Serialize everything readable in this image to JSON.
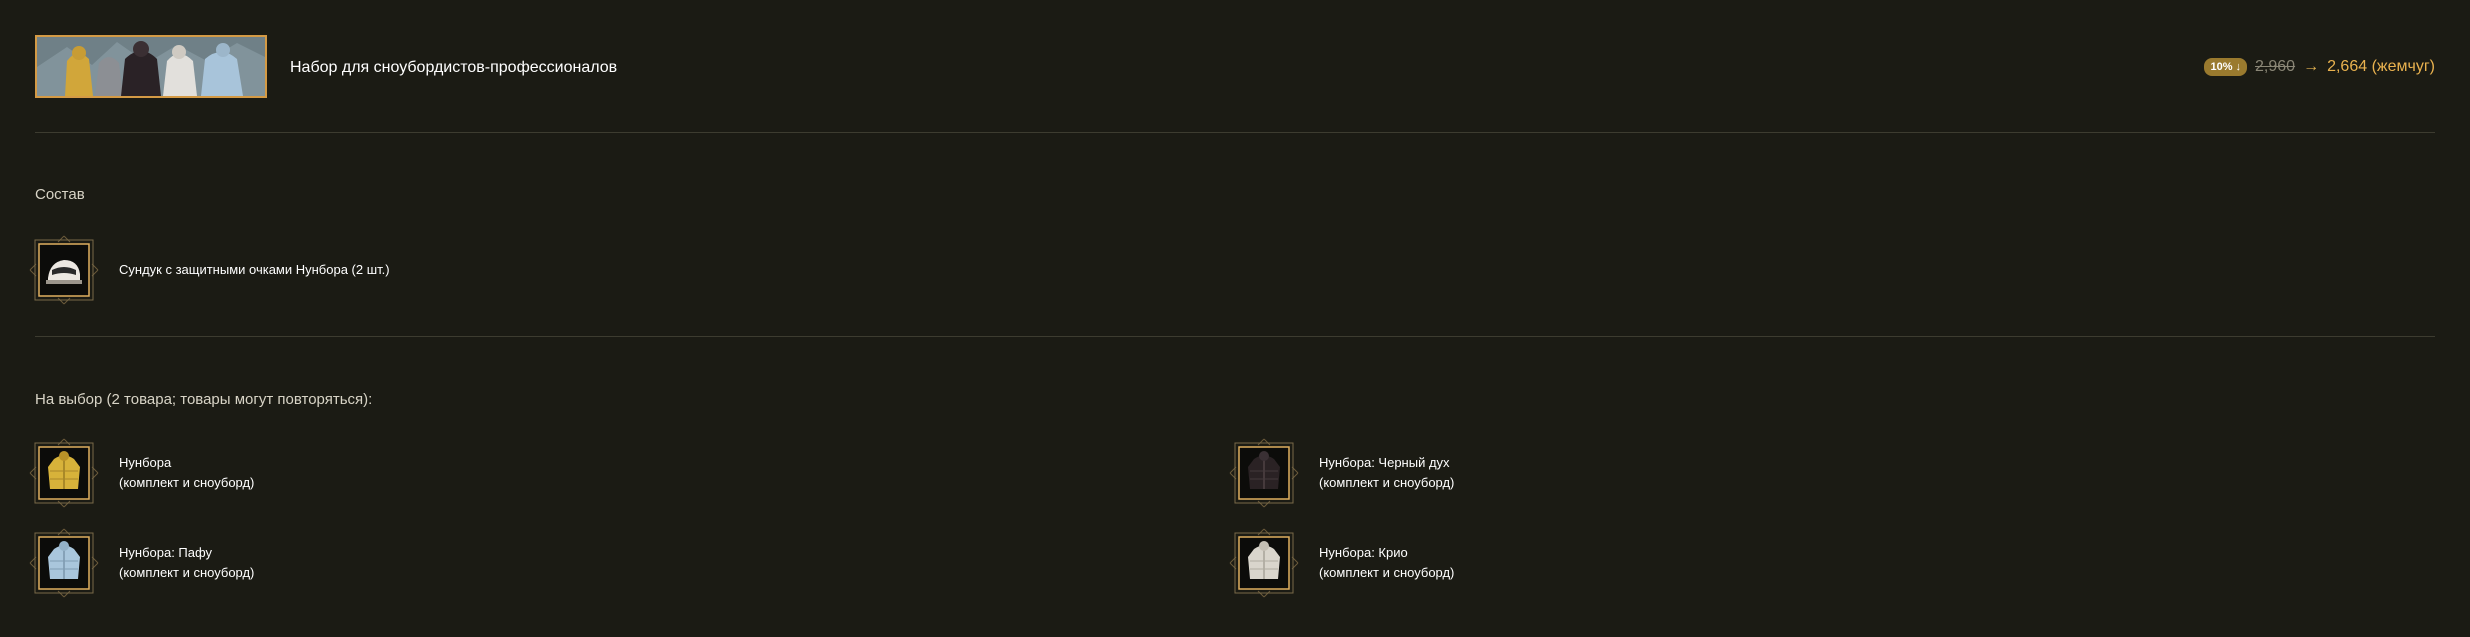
{
  "pack": {
    "title": "Набор для сноубордистов-профессионалов",
    "discount_badge": "10% ↓",
    "old_price": "2,960",
    "arrow": "→",
    "new_price": "2,664 (жемчуг)"
  },
  "contents": {
    "heading": "Состав",
    "items": [
      {
        "name": "Сундук с защитными очками Нунбора (2 шт.)",
        "icon": "goggles-chest-icon"
      }
    ]
  },
  "choice": {
    "heading": "На выбор (2 товара; товары могут повторяться):",
    "items": [
      {
        "name": "Нунбора",
        "sub": "(комплект и сноуборд)",
        "icon": "yellow-jacket-icon",
        "color": "#d7b23a"
      },
      {
        "name": "Нунбора: Черный дух",
        "sub": "(комплект и сноуборд)",
        "icon": "black-jacket-icon",
        "color": "#2a2224"
      },
      {
        "name": "Нунбора: Пафу",
        "sub": "(комплект и сноуборд)",
        "icon": "blue-jacket-icon",
        "color": "#a9c6dc"
      },
      {
        "name": "Нунбора: Крио",
        "sub": "(комплект и сноуборд)",
        "icon": "white-jacket-icon",
        "color": "#d9d5cc"
      }
    ]
  },
  "colors": {
    "accent_gold": "#d49a45",
    "price": "#e9b24f",
    "background": "#1b1b14"
  }
}
